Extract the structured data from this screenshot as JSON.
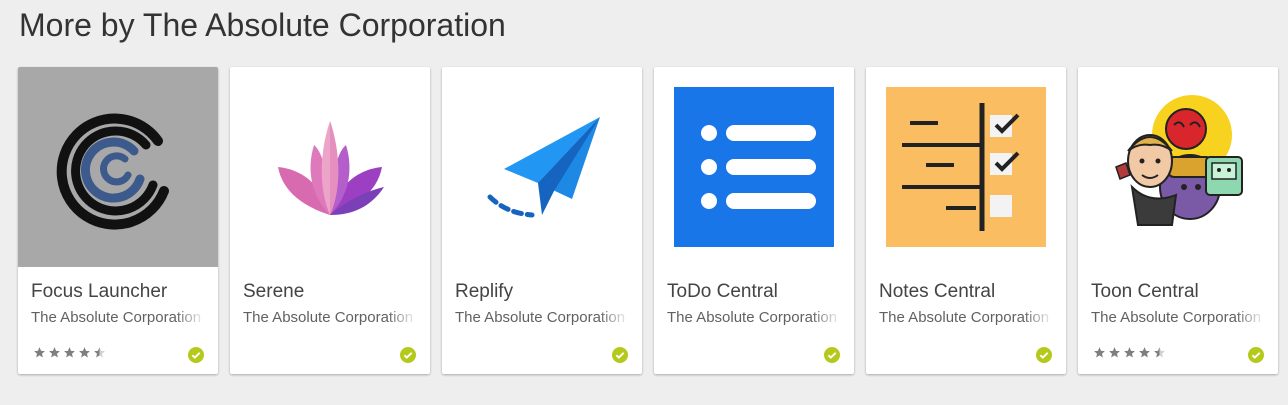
{
  "heading": "More by The Absolute Corporation",
  "colors": {
    "badge": "#b5c91d",
    "star_filled": "#7f7f7f",
    "star_empty": "#d2d2d2"
  },
  "apps": [
    {
      "title": "Focus Launcher",
      "developer": "The Absolute Corporation",
      "icon": "focus-launcher-icon",
      "rating": 4.5,
      "rating_shown": true,
      "verified": true
    },
    {
      "title": "Serene",
      "developer": "The Absolute Corporation",
      "icon": "lotus-icon",
      "rating_shown": false,
      "verified": true
    },
    {
      "title": "Replify",
      "developer": "The Absolute Corporation",
      "icon": "paper-plane-icon",
      "rating_shown": false,
      "verified": true
    },
    {
      "title": "ToDo Central",
      "developer": "The Absolute Corporation",
      "icon": "todo-list-icon",
      "rating_shown": false,
      "verified": true
    },
    {
      "title": "Notes Central",
      "developer": "The Absolute Corporation",
      "icon": "notes-checklist-icon",
      "rating_shown": false,
      "verified": true
    },
    {
      "title": "Toon Central",
      "developer": "The Absolute Corporation",
      "icon": "cartoon-characters-icon",
      "rating": 4.5,
      "rating_shown": true,
      "verified": true
    }
  ]
}
